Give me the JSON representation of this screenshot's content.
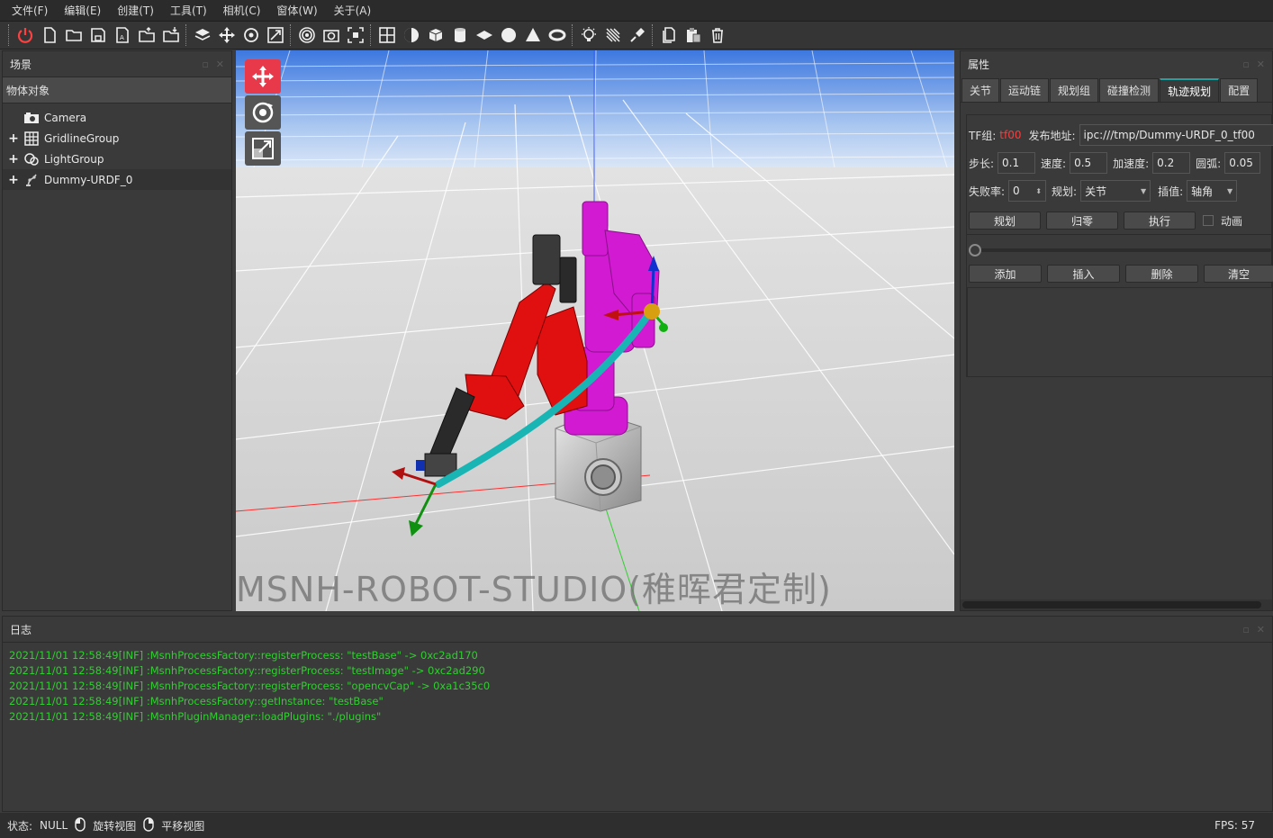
{
  "menu": [
    "文件(F)",
    "编辑(E)",
    "创建(T)",
    "工具(T)",
    "相机(C)",
    "窗体(W)",
    "关于(A)"
  ],
  "scene_panel": {
    "title": "场景",
    "header": "物体对象",
    "items": [
      {
        "label": "Camera",
        "icon": "camera-icon",
        "expandable": false
      },
      {
        "label": "GridlineGroup",
        "icon": "grid-icon",
        "expandable": true
      },
      {
        "label": "LightGroup",
        "icon": "light-icon",
        "expandable": true
      },
      {
        "label": "Dummy-URDF_0",
        "icon": "robot-icon",
        "expandable": true
      }
    ]
  },
  "viewport": {
    "watermark": "MSNH-ROBOT-STUDIO(稚晖君定制)",
    "tools": [
      "move-gizmo-icon",
      "rotate-gizmo-icon",
      "scale-gizmo-icon"
    ]
  },
  "properties": {
    "title": "属性",
    "tabs": [
      "关节",
      "运动链",
      "规划组",
      "碰撞检测",
      "轨迹规划",
      "配置"
    ],
    "active_tab": "轨迹规划",
    "tf_group_label": "TF组:",
    "tf_group_value": "tf00",
    "publish_label": "发布地址:",
    "publish_value": "ipc:///tmp/Dummy-URDF_0_tf00",
    "step_label": "步长:",
    "step_value": "0.1",
    "speed_label": "速度:",
    "speed_value": "0.5",
    "accel_label": "加速度:",
    "accel_value": "0.2",
    "arc_label": "圆弧:",
    "arc_value": "0.05",
    "fail_label": "失败率:",
    "fail_value": "0",
    "plan_label": "规划:",
    "plan_value": "关节",
    "interp_label": "插值:",
    "interp_value": "轴角",
    "btn_plan": "规划",
    "btn_home": "归零",
    "btn_exec": "执行",
    "anim_label": "动画",
    "slider_value": 0,
    "btn_add": "添加",
    "btn_insert": "插入",
    "btn_delete": "删除",
    "btn_clear": "清空"
  },
  "log": {
    "title": "日志",
    "lines": [
      "2021/11/01 12:58:49[INF] :MsnhProcessFactory::registerProcess: \"testBase\" -> 0xc2ad170",
      "2021/11/01 12:58:49[INF] :MsnhProcessFactory::registerProcess: \"testImage\" -> 0xc2ad290",
      "2021/11/01 12:58:49[INF] :MsnhProcessFactory::registerProcess: \"opencvCap\" -> 0xa1c35c0",
      "2021/11/01 12:58:49[INF] :MsnhProcessFactory::getInstance: \"testBase\"",
      "2021/11/01 12:58:49[INF] :MsnhPluginManager::loadPlugins: \"./plugins\""
    ]
  },
  "status": {
    "state_label": "状态:",
    "state_value": "NULL",
    "rotate_view": "旋转视图",
    "pan_view": "平移视图",
    "fps": "FPS: 57"
  },
  "colors": {
    "log_text": "#2fcf2f",
    "active_tab": "#25a0a0",
    "tf_value": "#ff3b3b",
    "trajectory": "#19b5b5",
    "robot_red": "#e01010",
    "robot_magenta": "#d21ad2"
  }
}
